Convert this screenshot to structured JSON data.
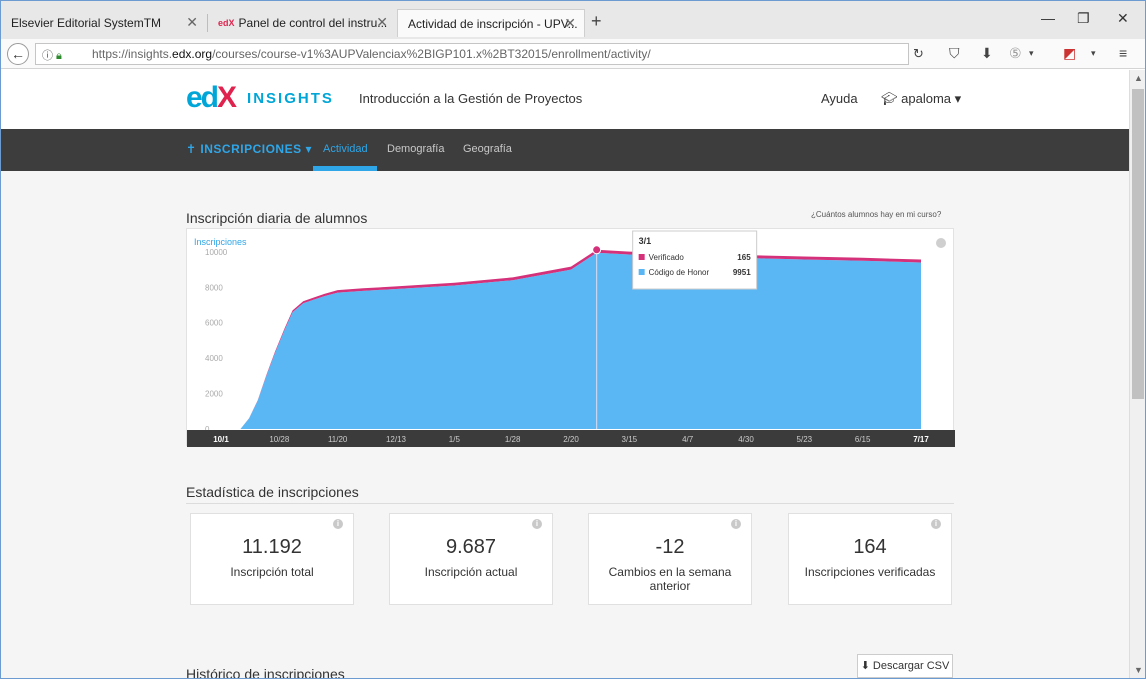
{
  "browser": {
    "tabs": [
      {
        "title": "Elsevier Editorial SystemTM",
        "active": false
      },
      {
        "title": "Panel de control del instru...",
        "favicon": "edX",
        "active": false
      },
      {
        "title": "Actividad de inscripción - UPV...",
        "active": true
      }
    ],
    "url_prefix": "https://insights.",
    "url_host": "edx.org",
    "url_rest": "/courses/course-v1%3AUPValenciax%2BIGP101.x%2BT32015/enrollment/activity/"
  },
  "header": {
    "logo_text": "INSIGHTS",
    "course_title": "Introducción a la Gestión de Proyectos",
    "help_label": "Ayuda",
    "user_name": "apaloma"
  },
  "subnav": {
    "section_label": "INSCRIPCIONES",
    "tabs": [
      "Actividad",
      "Demografía",
      "Geografía"
    ]
  },
  "chart_section": {
    "title": "Inscripción diaria de alumnos",
    "help_link": "¿Cuántos alumnos hay en mi curso?"
  },
  "chart_data": {
    "type": "area",
    "ylabel": "Inscripciones",
    "ylim": [
      0,
      10500
    ],
    "yticks": [
      0,
      2000,
      4000,
      6000,
      8000,
      10000
    ],
    "categories": [
      "10/1",
      "10/28",
      "11/20",
      "12/13",
      "1/5",
      "1/28",
      "2/20",
      "3/15",
      "4/7",
      "4/30",
      "5/23",
      "6/15",
      "7/17"
    ],
    "x": [
      "10/1",
      "10/10",
      "10/14",
      "10/18",
      "10/22",
      "10/26",
      "10/30",
      "11/3",
      "11/7",
      "11/11",
      "11/15",
      "11/20",
      "11/30",
      "12/13",
      "1/5",
      "1/28",
      "2/20",
      "3/1",
      "3/15",
      "4/7",
      "4/30",
      "5/23",
      "6/15",
      "7/17"
    ],
    "series": [
      {
        "name": "Código de Honor",
        "color": "#5bb7f4",
        "values": [
          0,
          0,
          600,
          1600,
          3000,
          4300,
          5600,
          6600,
          7100,
          7300,
          7500,
          7700,
          7800,
          7900,
          8100,
          8400,
          9000,
          9951,
          9851,
          9751,
          9651,
          9571,
          9501,
          9401
        ]
      },
      {
        "name": "Verificado",
        "color": "#d4317a",
        "values": [
          0,
          0,
          10,
          25,
          45,
          65,
          85,
          100,
          110,
          120,
          130,
          140,
          145,
          150,
          155,
          160,
          163,
          165,
          165,
          165,
          165,
          165,
          165,
          165
        ]
      }
    ],
    "tooltip": {
      "label": "3/1",
      "rows": [
        {
          "name": "Verificado",
          "value": "165",
          "color": "#d4317a"
        },
        {
          "name": "Código de Honor",
          "value": "9951",
          "color": "#5bb7f4"
        }
      ]
    },
    "legend": "none",
    "grid": false
  },
  "stats": {
    "title": "Estadística de inscripciones",
    "cards": [
      {
        "value": "11.192",
        "label": "Inscripción total"
      },
      {
        "value": "9.687",
        "label": "Inscripción actual"
      },
      {
        "value": "-12",
        "label": "Cambios en la semana anterior"
      },
      {
        "value": "164",
        "label": "Inscripciones verificadas"
      }
    ]
  },
  "history": {
    "title": "Histórico de inscripciones",
    "csv_button": "Descargar CSV"
  }
}
